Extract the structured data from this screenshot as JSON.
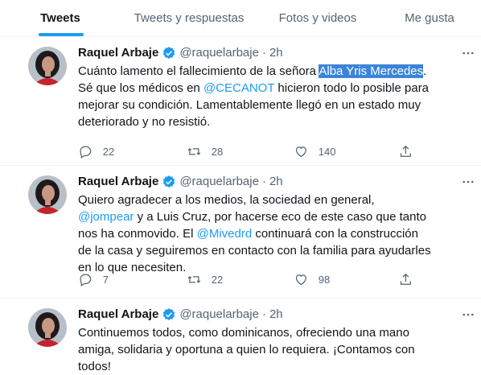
{
  "tabs": [
    {
      "label": "Tweets",
      "active": true
    },
    {
      "label": "Tweets y respuestas",
      "active": false
    },
    {
      "label": "Fotos y videos",
      "active": false
    },
    {
      "label": "Me gusta",
      "active": false
    }
  ],
  "colors": {
    "accent": "#1d9bf0",
    "selection": "#3a84d9",
    "muted": "#536471"
  },
  "tweets": [
    {
      "name": "Raquel Arbaje",
      "handle": "@raquelarbaje",
      "dot": "·",
      "time": "2h",
      "segments": [
        {
          "text": "Cuánto lamento el fallecimiento de la señora "
        },
        {
          "text": "Alba Yris Mercedes",
          "style": "highlight"
        },
        {
          "text": ". Sé que los médicos en "
        },
        {
          "text": "@CECANOT",
          "style": "link"
        },
        {
          "text": " hicieron todo lo posible para mejorar su condición. Lamentablemente llegó en un estado muy deteriorado y no resistió."
        }
      ],
      "replies": "22",
      "retweets": "28",
      "likes": "140"
    },
    {
      "name": "Raquel Arbaje",
      "handle": "@raquelarbaje",
      "dot": "·",
      "time": "2h",
      "segments": [
        {
          "text": "Quiero agradecer a los medios, la sociedad en general, "
        },
        {
          "text": "@jompear",
          "style": "link"
        },
        {
          "text": " y a Luis Cruz, por hacerse eco de este caso que tanto nos ha conmovido. El "
        },
        {
          "text": "@Mivedrd",
          "style": "link"
        },
        {
          "text": " continuará con la construcción de la casa y seguiremos en contacto con la familia para ayudarles en lo que necesiten."
        }
      ],
      "replies": "7",
      "retweets": "22",
      "likes": "98"
    },
    {
      "name": "Raquel Arbaje",
      "handle": "@raquelarbaje",
      "dot": "·",
      "time": "2h",
      "segments": [
        {
          "text": "Continuemos todos, como dominicanos, ofreciendo una mano amiga, solidaria y oportuna a quien lo requiera. ¡Contamos con todos!"
        }
      ]
    }
  ]
}
